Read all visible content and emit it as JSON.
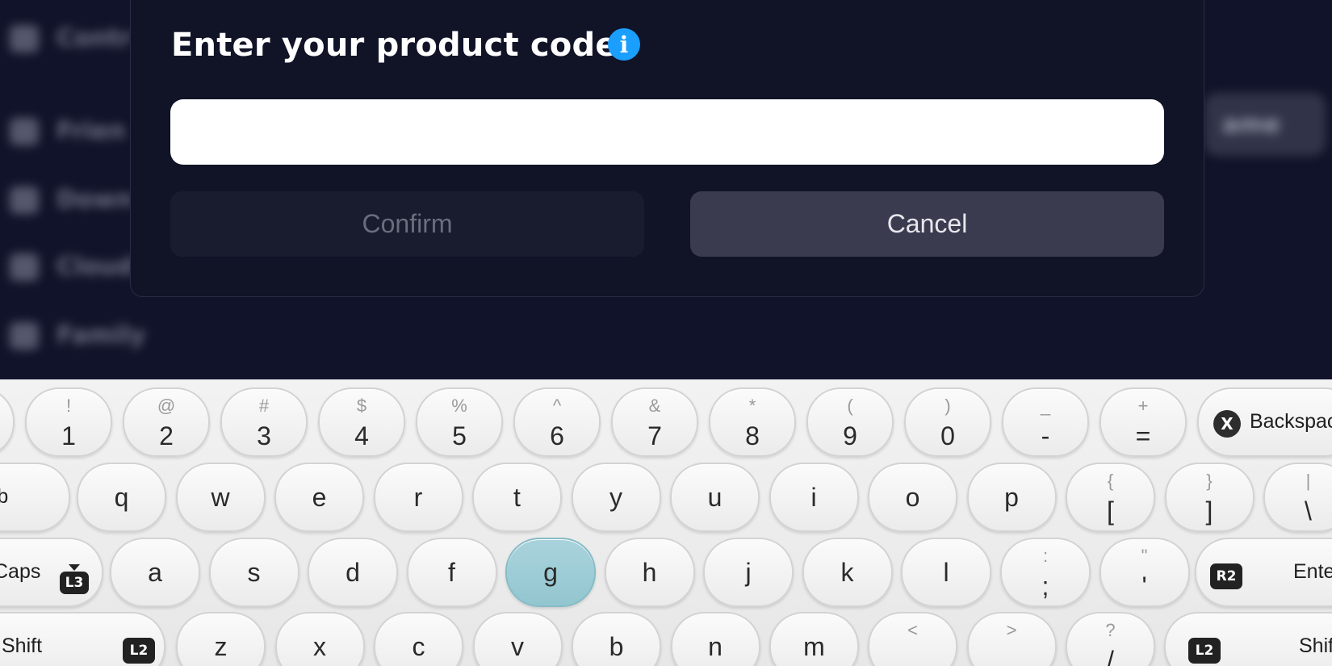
{
  "background_menu": {
    "items": [
      {
        "icon": "controller-icon",
        "label": "Contr"
      },
      {
        "icon": "friends-icon",
        "label": "Frien"
      },
      {
        "icon": "download-icon",
        "label": "Down"
      },
      {
        "icon": "cloud-icon",
        "label": "Cloud"
      },
      {
        "icon": "family-icon",
        "label": "Family"
      }
    ],
    "right_button_label": "ame"
  },
  "dialog": {
    "title": "Enter your product code",
    "info_icon": "info-icon",
    "code_input": {
      "value": "",
      "placeholder": ""
    },
    "confirm_label": "Confirm",
    "cancel_label": "Cancel",
    "accent_color": "#1a9fff"
  },
  "keyboard": {
    "number_row": [
      {
        "sec": "~",
        "pri": "`"
      },
      {
        "sec": "!",
        "pri": "1"
      },
      {
        "sec": "@",
        "pri": "2"
      },
      {
        "sec": "#",
        "pri": "3"
      },
      {
        "sec": "$",
        "pri": "4"
      },
      {
        "sec": "%",
        "pri": "5"
      },
      {
        "sec": "^",
        "pri": "6"
      },
      {
        "sec": "&",
        "pri": "7"
      },
      {
        "sec": "*",
        "pri": "8"
      },
      {
        "sec": "(",
        "pri": "9"
      },
      {
        "sec": ")",
        "pri": "0"
      },
      {
        "sec": "_",
        "pri": "-"
      },
      {
        "sec": "+",
        "pri": "="
      }
    ],
    "backspace": {
      "badge": "X",
      "label": "Backspace"
    },
    "qwerty_row": [
      "q",
      "w",
      "e",
      "r",
      "t",
      "y",
      "u",
      "i",
      "o",
      "p"
    ],
    "qwerty_extra": [
      {
        "sec": "{",
        "pri": "["
      },
      {
        "sec": "}",
        "pri": "]"
      },
      {
        "sec": "|",
        "pri": "\\"
      }
    ],
    "tab": {
      "label": "Tab"
    },
    "home_row": [
      "a",
      "s",
      "d",
      "f",
      "g",
      "h",
      "j",
      "k",
      "l"
    ],
    "home_extra": [
      {
        "sec": ":",
        "pri": ";"
      },
      {
        "sec": "\"",
        "pri": "'"
      }
    ],
    "caps": {
      "label": "Caps",
      "badge": "L3"
    },
    "enter": {
      "label": "Enter",
      "badge": "R2"
    },
    "bottom_row": [
      "z",
      "x",
      "c",
      "v",
      "b",
      "n",
      "m"
    ],
    "bottom_extra": [
      {
        "sec": "<",
        "pri": ","
      },
      {
        "sec": ">",
        "pri": "."
      },
      {
        "sec": "?",
        "pri": "/"
      }
    ],
    "shift_left": {
      "label": "Shift",
      "badge": "L2"
    },
    "shift_right": {
      "label": "Shift",
      "badge": "L2"
    },
    "highlighted_key": "g",
    "highlight_color": "#9fcdd6"
  }
}
